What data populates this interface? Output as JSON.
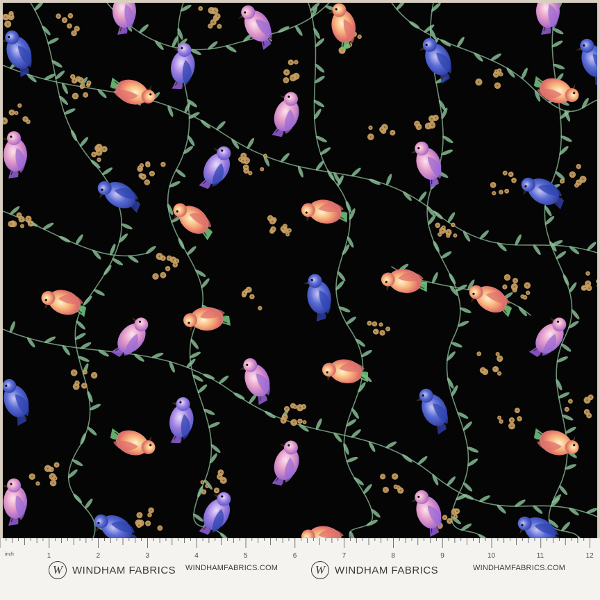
{
  "ruler": {
    "unit_label": "inch",
    "numbers": [
      "1",
      "2",
      "3",
      "4",
      "5",
      "6",
      "7",
      "8",
      "9",
      "10",
      "11",
      "12"
    ]
  },
  "footer": {
    "logo_letter": "W",
    "brand_name": "WINDHAM FABRICS",
    "website": "WINDHAMFABRICS.COM"
  },
  "colors": {
    "background": "#050505",
    "ruler_bg": "#f4f3ef",
    "border": "#d8cfc0",
    "branch": "#7fa98a",
    "blossom": "#c9a062",
    "bird_blue": "#4b63c9",
    "bird_pink": "#c98ad6",
    "bird_rainbow": "#f0b27a"
  }
}
